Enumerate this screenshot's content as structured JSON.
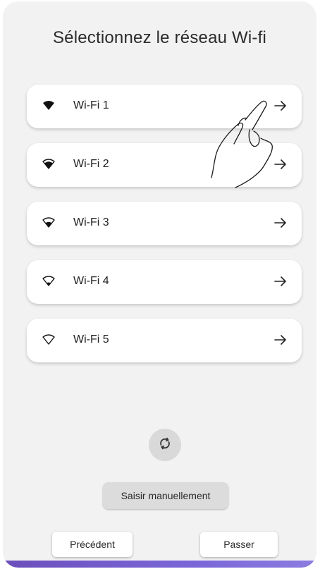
{
  "page": {
    "title": "Sélectionnez le réseau Wi-fi"
  },
  "networks": [
    {
      "label": "Wi-Fi 1",
      "signal": 4
    },
    {
      "label": "Wi-Fi 2",
      "signal": 3
    },
    {
      "label": "Wi-Fi 3",
      "signal": 2
    },
    {
      "label": "Wi-Fi 4",
      "signal": 1
    },
    {
      "label": "Wi-Fi 5",
      "signal": 0
    }
  ],
  "icons": {
    "network_signal": "wifi-signal-icon",
    "network_open": "arrow-right-icon",
    "refresh": "refresh-icon",
    "pointer": "hand-pointer-icon"
  },
  "actions": {
    "manual_label": "Saisir manuellement",
    "previous_label": "Précédent",
    "skip_label": "Passer"
  },
  "colors": {
    "background": "#f2f2f2",
    "card": "#ffffff",
    "accent": "#6b4fbb"
  }
}
